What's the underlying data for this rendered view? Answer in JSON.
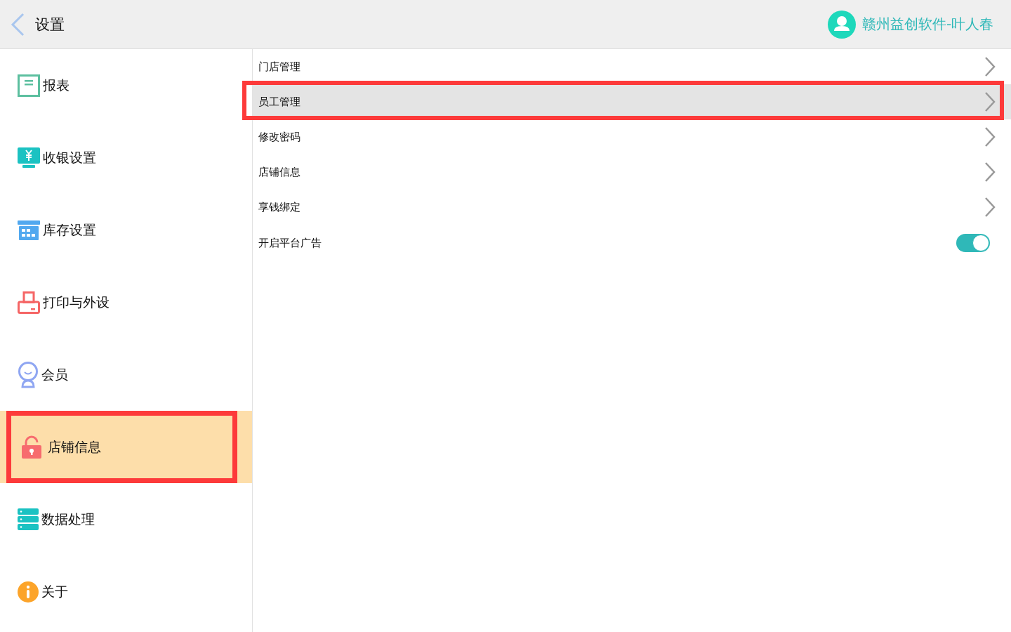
{
  "header": {
    "title": "设置",
    "user_name": "赣州益创软件-叶人春"
  },
  "sidebar": {
    "items": [
      {
        "label": "报表",
        "selected": false,
        "highlighted": false
      },
      {
        "label": "收银设置",
        "selected": false,
        "highlighted": false
      },
      {
        "label": "库存设置",
        "selected": false,
        "highlighted": false
      },
      {
        "label": "打印与外设",
        "selected": false,
        "highlighted": false
      },
      {
        "label": "会员",
        "selected": false,
        "highlighted": false
      },
      {
        "label": "店铺信息",
        "selected": true,
        "highlighted": true
      },
      {
        "label": "数据处理",
        "selected": false,
        "highlighted": false
      },
      {
        "label": "关于",
        "selected": false,
        "highlighted": false
      }
    ]
  },
  "settings": {
    "rows": [
      {
        "kind": "link",
        "label": "门店管理",
        "selected": false,
        "highlighted": false
      },
      {
        "kind": "link",
        "label": "员工管理",
        "selected": true,
        "highlighted": true
      },
      {
        "kind": "link",
        "label": "修改密码",
        "selected": false,
        "highlighted": false
      },
      {
        "kind": "link",
        "label": "店铺信息",
        "selected": false,
        "highlighted": false
      },
      {
        "kind": "link",
        "label": "享钱绑定",
        "selected": false,
        "highlighted": false
      },
      {
        "kind": "toggle",
        "label": "开启平台广告",
        "on": true
      }
    ]
  }
}
